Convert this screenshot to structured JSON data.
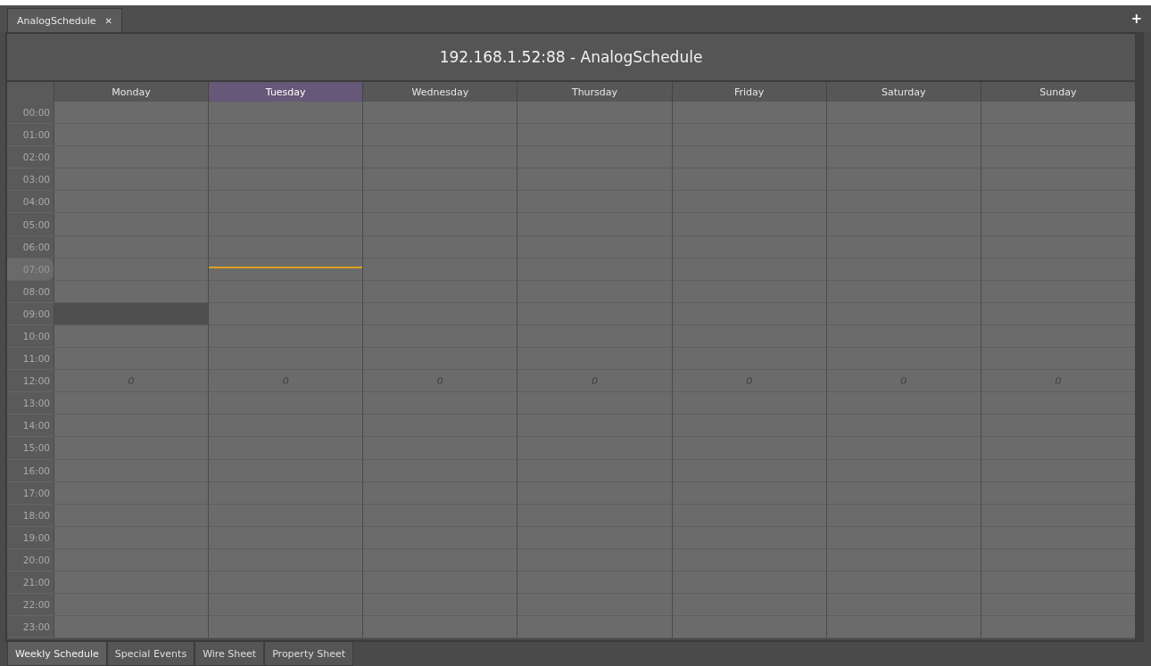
{
  "document_tab": {
    "label": "AnalogSchedule",
    "close": "✕"
  },
  "add_tab": "+",
  "title": "192.168.1.52:88 - AnalogSchedule",
  "days": [
    {
      "name": "Monday",
      "selected": false
    },
    {
      "name": "Tuesday",
      "selected": true
    },
    {
      "name": "Wednesday",
      "selected": false
    },
    {
      "name": "Thursday",
      "selected": false
    },
    {
      "name": "Friday",
      "selected": false
    },
    {
      "name": "Saturday",
      "selected": false
    },
    {
      "name": "Sunday",
      "selected": false
    }
  ],
  "rows": [
    {
      "time": "00:00",
      "current": false,
      "cells": [
        {
          "scheduled": false
        },
        {
          "scheduled": false
        },
        {
          "scheduled": false
        },
        {
          "scheduled": false
        },
        {
          "scheduled": false
        },
        {
          "scheduled": false
        },
        {
          "scheduled": false
        }
      ]
    },
    {
      "time": "01:00",
      "current": false,
      "cells": [
        {
          "scheduled": false
        },
        {
          "scheduled": false
        },
        {
          "scheduled": false
        },
        {
          "scheduled": false
        },
        {
          "scheduled": false
        },
        {
          "scheduled": false
        },
        {
          "scheduled": false
        }
      ]
    },
    {
      "time": "02:00",
      "current": false,
      "cells": [
        {
          "scheduled": false
        },
        {
          "scheduled": false
        },
        {
          "scheduled": false
        },
        {
          "scheduled": false
        },
        {
          "scheduled": false
        },
        {
          "scheduled": false
        },
        {
          "scheduled": false
        }
      ]
    },
    {
      "time": "03:00",
      "current": false,
      "cells": [
        {
          "scheduled": false
        },
        {
          "scheduled": false
        },
        {
          "scheduled": false
        },
        {
          "scheduled": false
        },
        {
          "scheduled": false
        },
        {
          "scheduled": false
        },
        {
          "scheduled": false
        }
      ]
    },
    {
      "time": "04:00",
      "current": false,
      "cells": [
        {
          "scheduled": false
        },
        {
          "scheduled": false
        },
        {
          "scheduled": false
        },
        {
          "scheduled": false
        },
        {
          "scheduled": false
        },
        {
          "scheduled": false
        },
        {
          "scheduled": false
        }
      ]
    },
    {
      "time": "05:00",
      "current": false,
      "cells": [
        {
          "scheduled": false
        },
        {
          "scheduled": false
        },
        {
          "scheduled": false
        },
        {
          "scheduled": false
        },
        {
          "scheduled": false
        },
        {
          "scheduled": false
        },
        {
          "scheduled": false
        }
      ]
    },
    {
      "time": "06:00",
      "current": false,
      "cells": [
        {
          "scheduled": false
        },
        {
          "scheduled": false
        },
        {
          "scheduled": false
        },
        {
          "scheduled": false
        },
        {
          "scheduled": false
        },
        {
          "scheduled": false
        },
        {
          "scheduled": false
        }
      ]
    },
    {
      "time": "07:00",
      "current": true,
      "cells": [
        {
          "scheduled": false
        },
        {
          "scheduled": false
        },
        {
          "scheduled": false
        },
        {
          "scheduled": false
        },
        {
          "scheduled": false
        },
        {
          "scheduled": false
        },
        {
          "scheduled": false
        }
      ]
    },
    {
      "time": "08:00",
      "current": false,
      "cells": [
        {
          "scheduled": false
        },
        {
          "scheduled": false
        },
        {
          "scheduled": false
        },
        {
          "scheduled": false
        },
        {
          "scheduled": false
        },
        {
          "scheduled": false
        },
        {
          "scheduled": false
        }
      ]
    },
    {
      "time": "09:00",
      "current": false,
      "cells": [
        {
          "scheduled": true
        },
        {
          "scheduled": false
        },
        {
          "scheduled": false
        },
        {
          "scheduled": false
        },
        {
          "scheduled": false
        },
        {
          "scheduled": false
        },
        {
          "scheduled": false
        }
      ]
    },
    {
      "time": "10:00",
      "current": false,
      "cells": [
        {
          "scheduled": false
        },
        {
          "scheduled": false
        },
        {
          "scheduled": false
        },
        {
          "scheduled": false
        },
        {
          "scheduled": false
        },
        {
          "scheduled": false
        },
        {
          "scheduled": false
        }
      ]
    },
    {
      "time": "11:00",
      "current": false,
      "cells": [
        {
          "scheduled": false
        },
        {
          "scheduled": false
        },
        {
          "scheduled": false
        },
        {
          "scheduled": false
        },
        {
          "scheduled": false
        },
        {
          "scheduled": false
        },
        {
          "scheduled": false
        }
      ]
    },
    {
      "time": "12:00",
      "current": false,
      "cells": [
        {
          "scheduled": false,
          "value": "0"
        },
        {
          "scheduled": false,
          "value": "0"
        },
        {
          "scheduled": false,
          "value": "0"
        },
        {
          "scheduled": false,
          "value": "0"
        },
        {
          "scheduled": false,
          "value": "0"
        },
        {
          "scheduled": false,
          "value": "0"
        },
        {
          "scheduled": false,
          "value": "0"
        }
      ]
    },
    {
      "time": "13:00",
      "current": false,
      "cells": [
        {
          "scheduled": false
        },
        {
          "scheduled": false
        },
        {
          "scheduled": false
        },
        {
          "scheduled": false
        },
        {
          "scheduled": false
        },
        {
          "scheduled": false
        },
        {
          "scheduled": false
        }
      ]
    },
    {
      "time": "14:00",
      "current": false,
      "cells": [
        {
          "scheduled": false
        },
        {
          "scheduled": false
        },
        {
          "scheduled": false
        },
        {
          "scheduled": false
        },
        {
          "scheduled": false
        },
        {
          "scheduled": false
        },
        {
          "scheduled": false
        }
      ]
    },
    {
      "time": "15:00",
      "current": false,
      "cells": [
        {
          "scheduled": false
        },
        {
          "scheduled": false
        },
        {
          "scheduled": false
        },
        {
          "scheduled": false
        },
        {
          "scheduled": false
        },
        {
          "scheduled": false
        },
        {
          "scheduled": false
        }
      ]
    },
    {
      "time": "16:00",
      "current": false,
      "cells": [
        {
          "scheduled": false
        },
        {
          "scheduled": false
        },
        {
          "scheduled": false
        },
        {
          "scheduled": false
        },
        {
          "scheduled": false
        },
        {
          "scheduled": false
        },
        {
          "scheduled": false
        }
      ]
    },
    {
      "time": "17:00",
      "current": false,
      "cells": [
        {
          "scheduled": false
        },
        {
          "scheduled": false
        },
        {
          "scheduled": false
        },
        {
          "scheduled": false
        },
        {
          "scheduled": false
        },
        {
          "scheduled": false
        },
        {
          "scheduled": false
        }
      ]
    },
    {
      "time": "18:00",
      "current": false,
      "cells": [
        {
          "scheduled": false
        },
        {
          "scheduled": false
        },
        {
          "scheduled": false
        },
        {
          "scheduled": false
        },
        {
          "scheduled": false
        },
        {
          "scheduled": false
        },
        {
          "scheduled": false
        }
      ]
    },
    {
      "time": "19:00",
      "current": false,
      "cells": [
        {
          "scheduled": false
        },
        {
          "scheduled": false
        },
        {
          "scheduled": false
        },
        {
          "scheduled": false
        },
        {
          "scheduled": false
        },
        {
          "scheduled": false
        },
        {
          "scheduled": false
        }
      ]
    },
    {
      "time": "20:00",
      "current": false,
      "cells": [
        {
          "scheduled": false
        },
        {
          "scheduled": false
        },
        {
          "scheduled": false
        },
        {
          "scheduled": false
        },
        {
          "scheduled": false
        },
        {
          "scheduled": false
        },
        {
          "scheduled": false
        }
      ]
    },
    {
      "time": "21:00",
      "current": false,
      "cells": [
        {
          "scheduled": false
        },
        {
          "scheduled": false
        },
        {
          "scheduled": false
        },
        {
          "scheduled": false
        },
        {
          "scheduled": false
        },
        {
          "scheduled": false
        },
        {
          "scheduled": false
        }
      ]
    },
    {
      "time": "22:00",
      "current": false,
      "cells": [
        {
          "scheduled": false
        },
        {
          "scheduled": false
        },
        {
          "scheduled": false
        },
        {
          "scheduled": false
        },
        {
          "scheduled": false
        },
        {
          "scheduled": false
        },
        {
          "scheduled": false
        }
      ]
    },
    {
      "time": "23:00",
      "current": false,
      "cells": [
        {
          "scheduled": false
        },
        {
          "scheduled": false
        },
        {
          "scheduled": false
        },
        {
          "scheduled": false
        },
        {
          "scheduled": false
        },
        {
          "scheduled": false
        },
        {
          "scheduled": false
        }
      ]
    }
  ],
  "view_tabs": [
    {
      "label": "Weekly Schedule",
      "selected": true
    },
    {
      "label": "Special Events",
      "selected": false
    },
    {
      "label": "Wire Sheet",
      "selected": false
    },
    {
      "label": "Property Sheet",
      "selected": false
    }
  ]
}
